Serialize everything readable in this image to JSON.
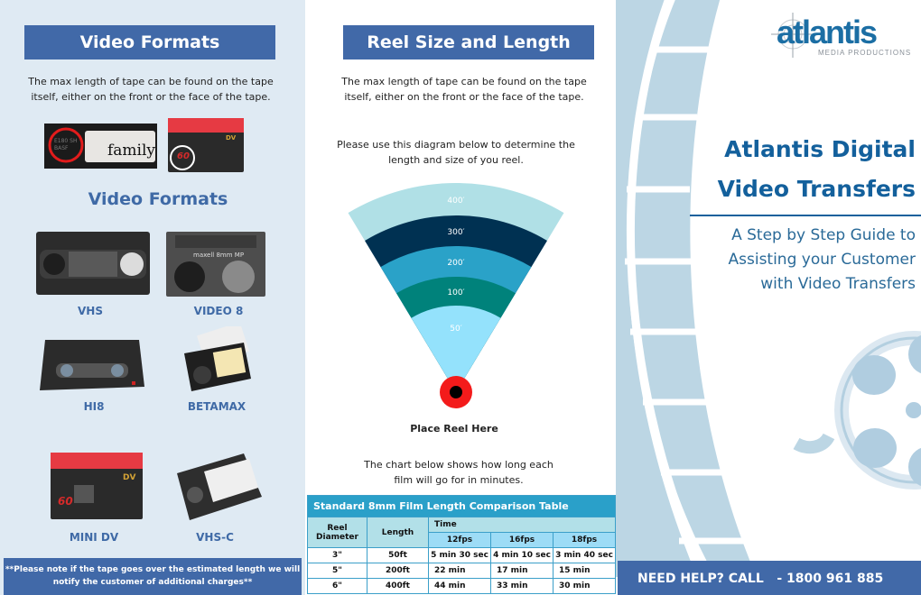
{
  "panel_left": {
    "banner": "Video Formats",
    "intro": "The max length of tape can be found on the tape itself, either on the front or the face of the tape.",
    "examples": [
      {
        "name": "vhs-label-example",
        "label_text": "family",
        "circled_text": "E180 SH BASF"
      },
      {
        "name": "minidv-label-example",
        "circled_text": "60"
      }
    ],
    "formats_title": "Video Formats",
    "formats": [
      {
        "label": "VHS"
      },
      {
        "label": "VIDEO 8"
      },
      {
        "label": "HI8"
      },
      {
        "label": "BETAMAX"
      },
      {
        "label": "MINI DV"
      },
      {
        "label": "VHS-C"
      }
    ],
    "note": "**Please note if the tape goes over the estimated length we will notify the customer of additional charges**"
  },
  "panel_middle": {
    "banner": "Reel Size and Length",
    "intro": "The max length of tape can be found on the tape itself, either on the front or the face of the tape.",
    "diagram_intro": "Please use this diagram below to determine the length and size of you reel.",
    "diagram": {
      "bands": [
        {
          "label": "400′",
          "color": "#b0e0e6"
        },
        {
          "label": "300′",
          "color": "#003152"
        },
        {
          "label": "200′",
          "color": "#2aa2c8"
        },
        {
          "label": "100′",
          "color": "#00827b"
        },
        {
          "label": "50′",
          "color": "#94e2fc"
        }
      ],
      "center_label": "Place Reel Here"
    },
    "chart_intro": "The chart below shows how long each film will go for in minutes.",
    "table": {
      "title": "Standard 8mm Film Length Comparison Table",
      "col_reel": "Reel Diameter",
      "col_length": "Length",
      "col_time": "Time",
      "fps": [
        "12fps",
        "16fps",
        "18fps"
      ],
      "rows": [
        {
          "diameter": "3\"",
          "length": "50ft",
          "t12": "5 min 30 sec",
          "t16": "4 min 10 sec",
          "t18": "3 min 40 sec"
        },
        {
          "diameter": "5\"",
          "length": "200ft",
          "t12": "22 min",
          "t16": "17 min",
          "t18": "15 min"
        },
        {
          "diameter": "6\"",
          "length": "400ft",
          "t12": "44 min",
          "t16": "33 min",
          "t18": "30 min"
        }
      ]
    }
  },
  "panel_right": {
    "logo_main": "atlantis",
    "logo_sub": "MEDIA PRODUCTIONS",
    "title_line1": "Atlantis Digital",
    "title_line2": "Video Transfers",
    "subtitle_line1": "A Step by Step Guide to",
    "subtitle_line2": "Assisting your Customer",
    "subtitle_line3": "with Video Transfers",
    "help": "NEED HELP? CALL   - 1800 961 885"
  },
  "colors": {
    "banner": "#4169a8",
    "title_blue": "#13609c",
    "left_bg": "#dfeaf3",
    "film_strip": "#bcd6e4"
  }
}
